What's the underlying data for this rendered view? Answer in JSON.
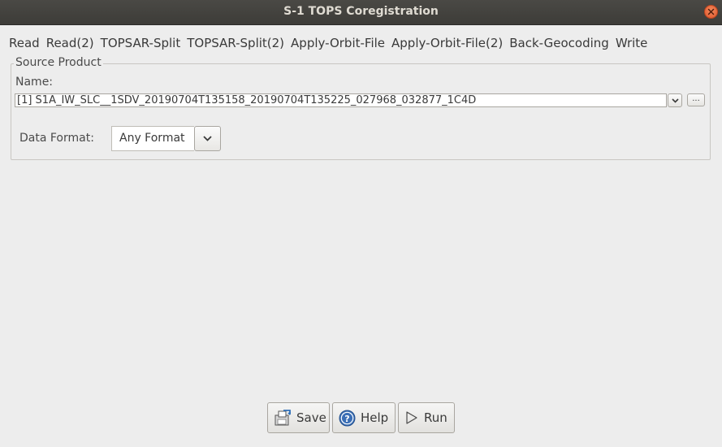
{
  "window": {
    "title": "S-1 TOPS Coregistration"
  },
  "tabs": [
    {
      "label": "Read"
    },
    {
      "label": "Read(2)"
    },
    {
      "label": "TOPSAR-Split"
    },
    {
      "label": "TOPSAR-Split(2)"
    },
    {
      "label": "Apply-Orbit-File"
    },
    {
      "label": "Apply-Orbit-File(2)"
    },
    {
      "label": "Back-Geocoding"
    },
    {
      "label": "Write"
    }
  ],
  "source_product": {
    "title": "Source Product",
    "name_label": "Name:",
    "name_value": "[1] S1A_IW_SLC__1SDV_20190704T135158_20190704T135225_027968_032877_1C4D",
    "browse_label": "...",
    "data_format_label": "Data Format:",
    "data_format_value": "Any Format"
  },
  "buttons": {
    "save": "Save",
    "help": "Help",
    "run": "Run"
  },
  "icons": {
    "close": "close-icon",
    "dropdown": "chevron-down-icon",
    "save": "save-icon",
    "help": "help-icon",
    "run": "play-icon"
  },
  "colors": {
    "titlebar": "#3d3c38",
    "close_button": "#e0542a",
    "background": "#ededed",
    "help_icon": "#3b6fb6"
  }
}
